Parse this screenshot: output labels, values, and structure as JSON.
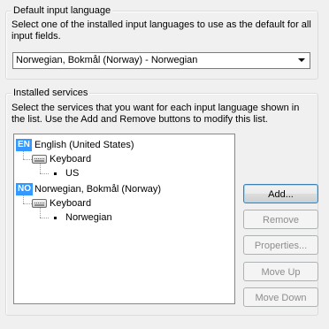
{
  "default_input_language": {
    "title": "Default input language",
    "description": "Select one of the installed input languages to use as the default for all input fields.",
    "selected": "Norwegian, Bokmål (Norway) - Norwegian"
  },
  "installed_services": {
    "title": "Installed services",
    "description": "Select the services that you want for each input language shown in the list. Use the Add and Remove buttons to modify this list.",
    "tree": {
      "lang1": {
        "code": "EN",
        "name": "English (United States)",
        "category": "Keyboard",
        "layout": "US"
      },
      "lang2": {
        "code": "NO",
        "name": "Norwegian, Bokmål (Norway)",
        "category": "Keyboard",
        "layout": "Norwegian"
      }
    },
    "buttons": {
      "add": "Add...",
      "remove": "Remove",
      "properties": "Properties...",
      "move_up": "Move Up",
      "move_down": "Move Down"
    }
  }
}
